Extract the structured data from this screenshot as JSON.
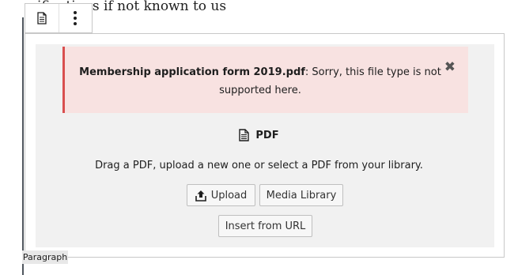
{
  "background_text": "…ifications if not known to us",
  "toolbar": {
    "block_icon": "file-icon",
    "more_icon": "more-vertical-icon"
  },
  "notice": {
    "filename": "Membership application form 2019.pdf",
    "message": ": Sorry, this file type is not supported here.",
    "close_icon": "close-icon",
    "colors": {
      "background": "#f8e2e1",
      "border": "#d94f4f"
    }
  },
  "placeholder": {
    "icon": "file-pdf-icon",
    "label": "PDF",
    "instructions": "Drag a PDF, upload a new one or select a PDF from your library."
  },
  "buttons": {
    "upload": "Upload",
    "upload_icon": "upload-icon",
    "media_library": "Media Library",
    "insert_url": "Insert from URL"
  },
  "block_label": "Paragraph"
}
